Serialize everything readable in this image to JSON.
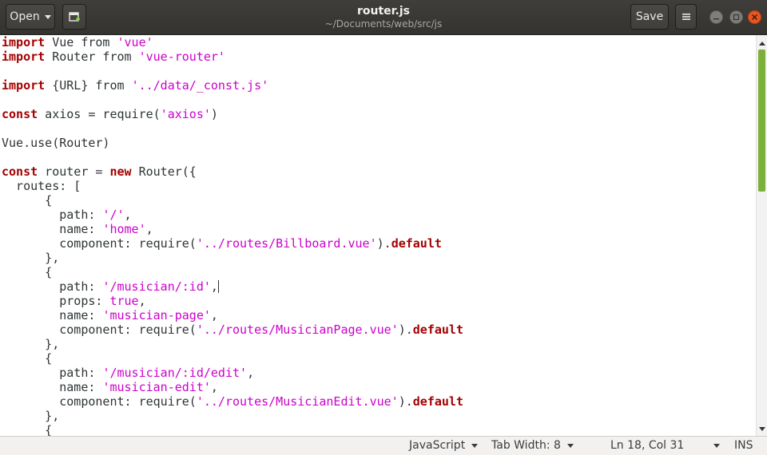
{
  "header": {
    "open_label": "Open",
    "save_label": "Save",
    "title": "router.js",
    "subtitle": "~/Documents/web/src/js"
  },
  "colors": {
    "keyword": "#a40000",
    "string": "#cc00cc",
    "close_button": "#e95420",
    "scroll_thumb": "#7daf3b"
  },
  "icons": {
    "open_menu": "chevron-down-icon",
    "new_tab": "new-document-icon",
    "hamburger": "menu-icon",
    "minimize": "minimize-icon",
    "maximize": "maximize-icon",
    "close": "close-icon"
  },
  "editor": {
    "lines": [
      [
        {
          "t": "kw",
          "v": "import"
        },
        {
          "t": "",
          "v": " Vue from "
        },
        {
          "t": "str",
          "v": "'vue'"
        }
      ],
      [
        {
          "t": "kw",
          "v": "import"
        },
        {
          "t": "",
          "v": " Router from "
        },
        {
          "t": "str",
          "v": "'vue-router'"
        }
      ],
      [],
      [
        {
          "t": "kw",
          "v": "import"
        },
        {
          "t": "",
          "v": " {URL} from "
        },
        {
          "t": "str",
          "v": "'../data/_const.js'"
        }
      ],
      [],
      [
        {
          "t": "kw",
          "v": "const"
        },
        {
          "t": "",
          "v": " axios = require("
        },
        {
          "t": "str",
          "v": "'axios'"
        },
        {
          "t": "",
          "v": ")"
        }
      ],
      [],
      [
        {
          "t": "",
          "v": "Vue.use(Router)"
        }
      ],
      [],
      [
        {
          "t": "kw",
          "v": "const"
        },
        {
          "t": "",
          "v": " router = "
        },
        {
          "t": "kw",
          "v": "new"
        },
        {
          "t": "",
          "v": " Router({"
        }
      ],
      [
        {
          "t": "",
          "v": "  routes: ["
        }
      ],
      [
        {
          "t": "",
          "v": "      {"
        }
      ],
      [
        {
          "t": "",
          "v": "        path: "
        },
        {
          "t": "str",
          "v": "'/'"
        },
        {
          "t": "",
          "v": ","
        }
      ],
      [
        {
          "t": "",
          "v": "        name: "
        },
        {
          "t": "str",
          "v": "'home'"
        },
        {
          "t": "",
          "v": ","
        }
      ],
      [
        {
          "t": "",
          "v": "        component: require("
        },
        {
          "t": "str",
          "v": "'../routes/Billboard.vue'"
        },
        {
          "t": "",
          "v": ")."
        },
        {
          "t": "kw",
          "v": "default"
        }
      ],
      [
        {
          "t": "",
          "v": "      },"
        }
      ],
      [
        {
          "t": "",
          "v": "      {"
        }
      ],
      [
        {
          "t": "",
          "v": "        path: "
        },
        {
          "t": "str",
          "v": "'/musician/:id'"
        },
        {
          "t": "",
          "v": ","
        },
        {
          "t": "cursor",
          "v": ""
        }
      ],
      [
        {
          "t": "",
          "v": "        props: "
        },
        {
          "t": "lit",
          "v": "true"
        },
        {
          "t": "",
          "v": ","
        }
      ],
      [
        {
          "t": "",
          "v": "        name: "
        },
        {
          "t": "str",
          "v": "'musician-page'"
        },
        {
          "t": "",
          "v": ","
        }
      ],
      [
        {
          "t": "",
          "v": "        component: require("
        },
        {
          "t": "str",
          "v": "'../routes/MusicianPage.vue'"
        },
        {
          "t": "",
          "v": ")."
        },
        {
          "t": "kw",
          "v": "default"
        }
      ],
      [
        {
          "t": "",
          "v": "      },"
        }
      ],
      [
        {
          "t": "",
          "v": "      {"
        }
      ],
      [
        {
          "t": "",
          "v": "        path: "
        },
        {
          "t": "str",
          "v": "'/musician/:id/edit'"
        },
        {
          "t": "",
          "v": ","
        }
      ],
      [
        {
          "t": "",
          "v": "        name: "
        },
        {
          "t": "str",
          "v": "'musician-edit'"
        },
        {
          "t": "",
          "v": ","
        }
      ],
      [
        {
          "t": "",
          "v": "        component: require("
        },
        {
          "t": "str",
          "v": "'../routes/MusicianEdit.vue'"
        },
        {
          "t": "",
          "v": ")."
        },
        {
          "t": "kw",
          "v": "default"
        }
      ],
      [
        {
          "t": "",
          "v": "      },"
        }
      ],
      [
        {
          "t": "",
          "v": "      {"
        }
      ]
    ]
  },
  "status": {
    "language": "JavaScript",
    "tab_width": "Tab Width: 8",
    "position": "Ln 18, Col 31",
    "mode": "INS"
  }
}
